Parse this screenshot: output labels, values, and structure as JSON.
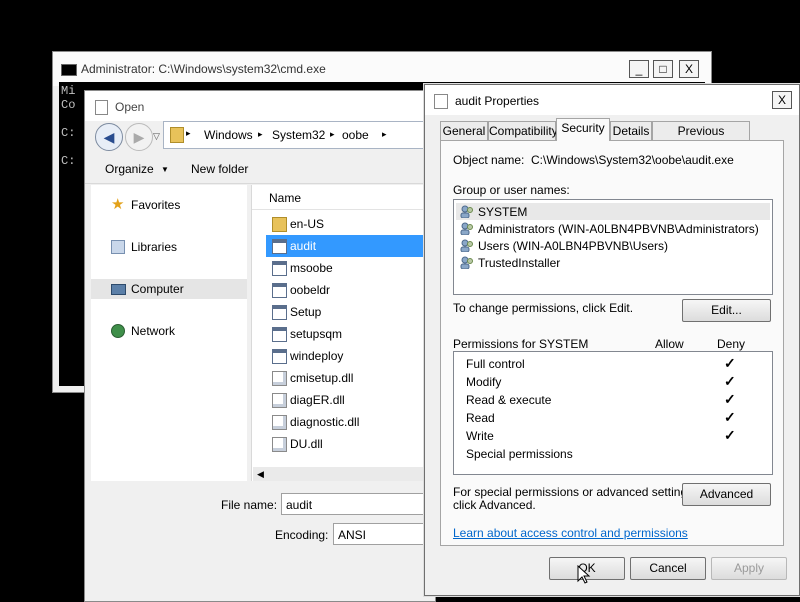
{
  "cmd": {
    "title": "Administrator: C:\\Windows\\system32\\cmd.exe",
    "lines": [
      "Mi",
      "Co",
      "",
      "C:",
      "",
      "C:"
    ],
    "minimize": "_",
    "maximize": "□",
    "close": "X"
  },
  "open_dialog": {
    "title": "Open",
    "breadcrumb": [
      "Windows",
      "System32",
      "oobe"
    ],
    "toolbar": {
      "organize": "Organize",
      "new_folder": "New folder"
    },
    "nav": [
      "Favorites",
      "Libraries",
      "Computer",
      "Network"
    ],
    "column_name": "Name",
    "files": [
      {
        "name": "en-US",
        "icon": "folder-icon"
      },
      {
        "name": "audit",
        "icon": "app-icon"
      },
      {
        "name": "msoobe",
        "icon": "app-icon"
      },
      {
        "name": "oobeldr",
        "icon": "app-icon"
      },
      {
        "name": "Setup",
        "icon": "app-icon"
      },
      {
        "name": "setupsqm",
        "icon": "app-icon"
      },
      {
        "name": "windeploy",
        "icon": "app-icon"
      },
      {
        "name": "cmisetup.dll",
        "icon": "dll-icon"
      },
      {
        "name": "diagER.dll",
        "icon": "dll-icon"
      },
      {
        "name": "diagnostic.dll",
        "icon": "dll-icon"
      },
      {
        "name": "DU.dll",
        "icon": "dll-icon"
      }
    ],
    "file_name_label": "File name:",
    "file_name_value": "audit",
    "encoding_label": "Encoding:",
    "encoding_value": "ANSI"
  },
  "props": {
    "title": "audit Properties",
    "close": "X",
    "tabs": [
      "General",
      "Compatibility",
      "Security",
      "Details",
      "Previous Versions"
    ],
    "active_tab": "Security",
    "object_name_label": "Object name:",
    "object_name_value": "C:\\Windows\\System32\\oobe\\audit.exe",
    "group_label": "Group or user names:",
    "users": [
      "SYSTEM",
      "Administrators (WIN-A0LBN4PBVNB\\Administrators)",
      "Users (WIN-A0LBN4PBVNB\\Users)",
      "TrustedInstaller"
    ],
    "change_text": "To change permissions, click Edit.",
    "edit_button": "Edit...",
    "perms_label": "Permissions for SYSTEM",
    "allow_label": "Allow",
    "deny_label": "Deny",
    "permissions": [
      {
        "name": "Full control",
        "deny": "✓"
      },
      {
        "name": "Modify",
        "deny": "✓"
      },
      {
        "name": "Read & execute",
        "deny": "✓"
      },
      {
        "name": "Read",
        "deny": "✓"
      },
      {
        "name": "Write",
        "deny": "✓"
      },
      {
        "name": "Special permissions",
        "deny": ""
      }
    ],
    "special_text_1": "For special permissions or advanced settings,",
    "special_text_2": "click Advanced.",
    "advanced_button": "Advanced",
    "link_text": "Learn about access control and permissions",
    "ok_button": "OK",
    "cancel_button": "Cancel",
    "apply_button": "Apply"
  },
  "colors": {
    "selection": "#3399ff",
    "link": "#0066cc",
    "folder": "#e8c25a"
  }
}
